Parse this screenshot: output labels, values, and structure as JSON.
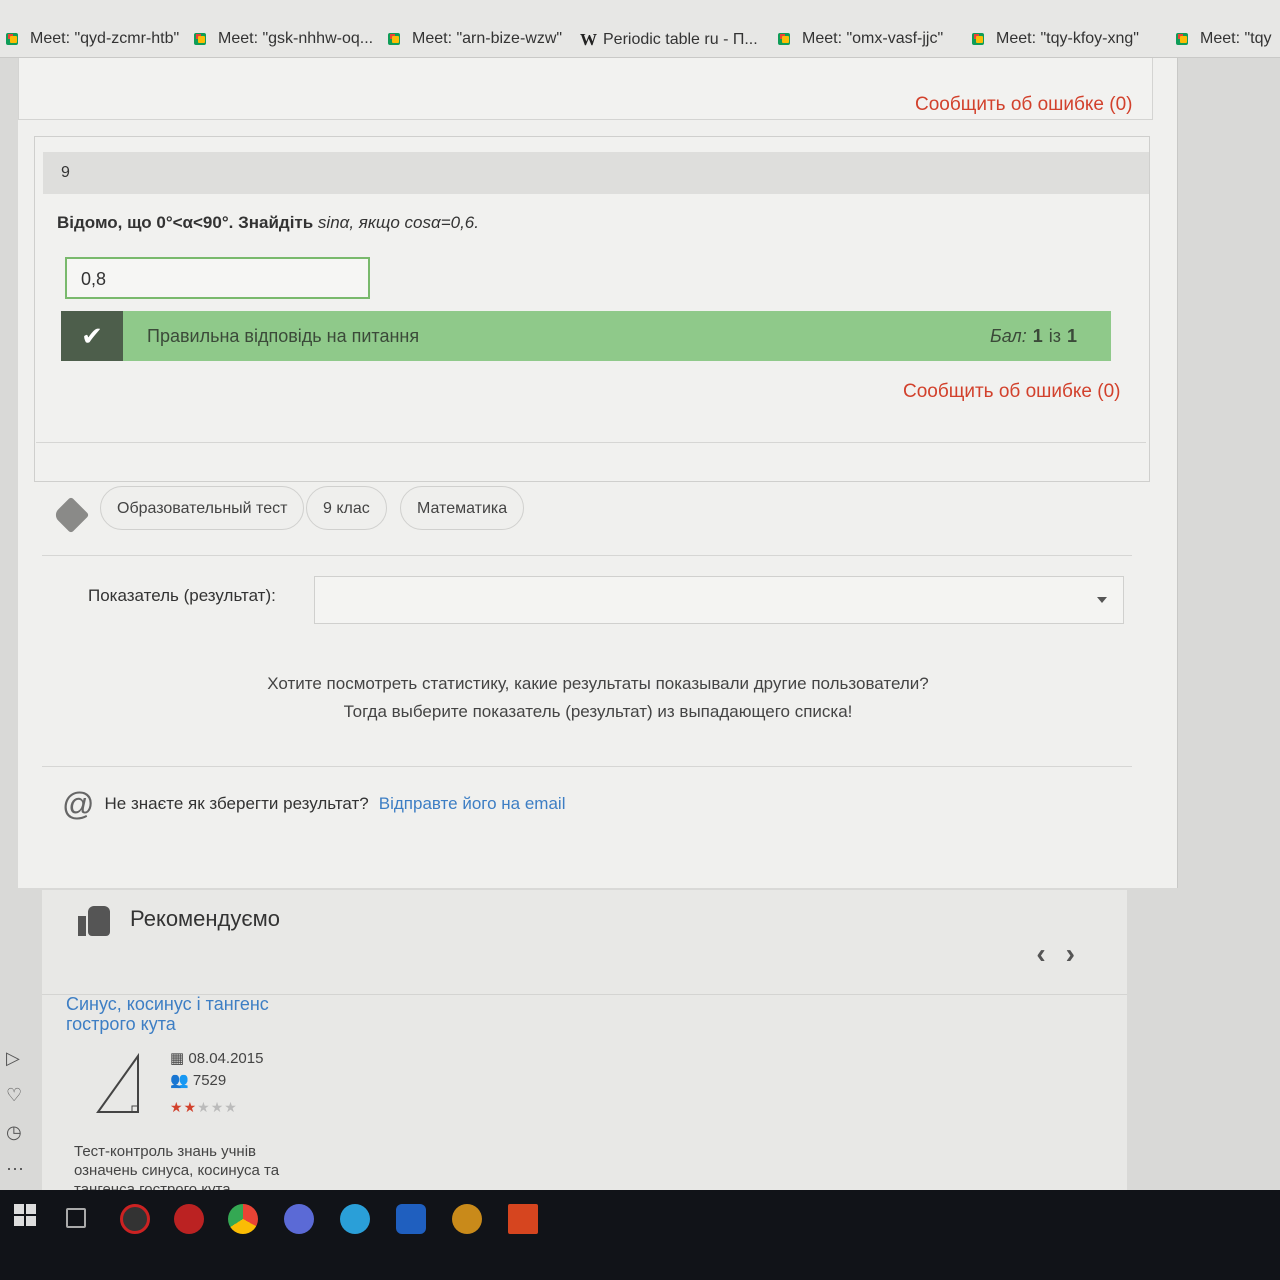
{
  "bookmarks": [
    {
      "label": "Meet: \"qyd-zcmr-htb\"",
      "icon": "meet-icon"
    },
    {
      "label": "Meet: \"gsk-nhhw-oq...",
      "icon": "meet-icon"
    },
    {
      "label": "Meet: \"arn-bize-wzw\"",
      "icon": "meet-icon"
    },
    {
      "label": "Periodic table ru - П...",
      "icon": "wikipedia-icon"
    },
    {
      "label": "Meet: \"omx-vasf-jjc\"",
      "icon": "meet-icon"
    },
    {
      "label": "Meet: \"tqy-kfoy-xng\"",
      "icon": "meet-icon"
    },
    {
      "label": "Meet: \"tqy",
      "icon": "meet-icon"
    }
  ],
  "report_error_label": "Сообщить об ошибке (0)",
  "question": {
    "number": "9",
    "text_bold": "Відомо, що 0°<α<90°. Знайдіть ",
    "text_italic": "sinα, якщо cosα=0,6.",
    "answer_value": "0,8",
    "result_text": "Правильна відповідь на питання",
    "score_label": "Бал:",
    "score_value": "1",
    "score_of": "із",
    "score_max": "1"
  },
  "tags": [
    "Образовательный тест",
    "9 клас",
    "Математика"
  ],
  "indicator": {
    "label": "Показатель (результат):",
    "selected": ""
  },
  "stats_text": {
    "line1": "Хотите посмотреть статистику, какие результаты показывали другие пользователи?",
    "line2": "Тогда выберите показатель (результат) из выпадающего списка!"
  },
  "save": {
    "question": "Не знаєте як зберегти результат?",
    "link": "Відправте його на email"
  },
  "recommend": {
    "title": "Рекомендуємо",
    "item": {
      "title": "Синус, косинус і тангенс гострого кута",
      "date": "08.04.2015",
      "views": "7529",
      "rating": 2,
      "rating_max": 5,
      "description": "Тест-контроль знань учнів означень синуса, косинуса та тангенса гострого кута"
    }
  },
  "colors": {
    "success_bar": "#8fc98a",
    "error_link": "#d2412c",
    "link": "#3d7ec4"
  }
}
